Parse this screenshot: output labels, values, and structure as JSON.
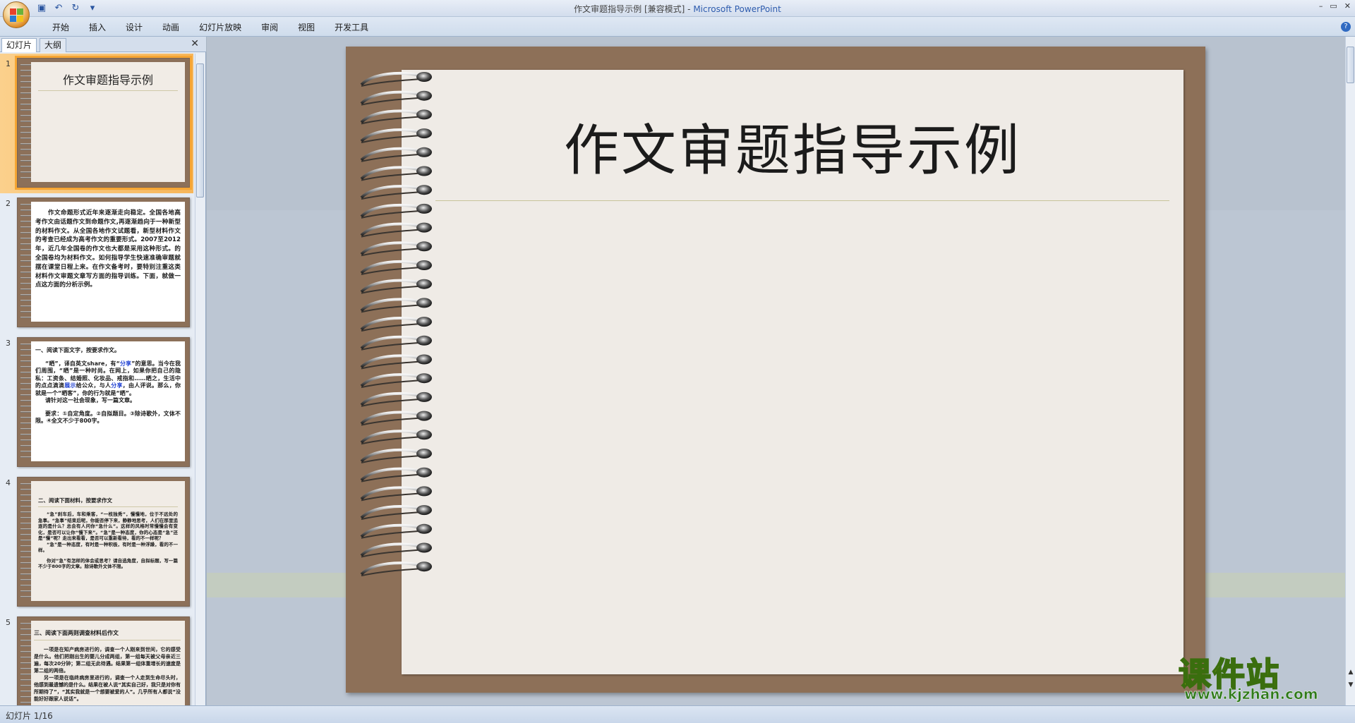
{
  "window": {
    "title": "作文审题指导示例 [兼容模式]",
    "app": "Microsoft PowerPoint",
    "separator": " - "
  },
  "quick_access": [
    {
      "name": "save-icon",
      "glyph": "▣"
    },
    {
      "name": "undo-icon",
      "glyph": "↶"
    },
    {
      "name": "redo-icon",
      "glyph": "↻"
    },
    {
      "name": "customize-icon",
      "glyph": "▾"
    }
  ],
  "window_buttons": [
    "–",
    "▭",
    "✕"
  ],
  "ribbon_tabs": [
    "开始",
    "插入",
    "设计",
    "动画",
    "幻灯片放映",
    "审阅",
    "视图",
    "开发工具"
  ],
  "help_glyph": "?",
  "panel": {
    "tabs": [
      "幻灯片",
      "大纲"
    ],
    "close_glyph": "✕"
  },
  "thumbnails": [
    {
      "num": "1",
      "title": "作文审题指导示例"
    },
    {
      "num": "2",
      "text": "作文命题形式近年来逐渐走向稳定。全国各地高考作文由话题作文到命题作文,再逐渐趋向于一种新型的材料作文。从全国各地作文试题看，新型材料作文的考查已经成为高考作文的重要形式。2007至2012年，近几年全国卷的作文也大都是采用这种形式。的全国卷均为材料作文。如何指导学生快速准确审题就摆在课堂日程上来。在作文备考时，要特别注重这类材料作文审题文章写方面的指导训练。下面，就做一点这方面的分析示例。"
    },
    {
      "num": "3",
      "heading": "一、阅读下面文字，按要求作文。",
      "body1": "“晒”，译自英文share，有“",
      "blue1": "分享",
      "body2": "”的意思。当今在我们周围，“晒”是一种时尚。在网上，如果你把自己的隐私：工资条、结婚照、化妆品、戒指和……晒之，生活中的点点滴滴",
      "blue2": "展示",
      "body3": "给公众，与人",
      "blue3": "分享",
      "body4": "，由人评说。那么，你就是一个“晒客”，你的行为就是“晒”。",
      "body5": "请针对这一社会现象，写一篇文章。",
      "req": "要求：①自定角度。②自拟题目。③除诗歌外，文体不限。④全文不少于800字。"
    },
    {
      "num": "4",
      "heading": "二、阅读下面材料，按要求作文",
      "body": "“急”刹车后，车和乘客，“一枝独秀”，慢慢地，位于不远处的急事。“急事”结束后呢，你能否停下来，静静地思考，人们在那里追逐的是什么？总会有人问你“急什么”。这样的风格时常慢慢会有变化，是否可以让你“慢下来”。“急”是一种态度，你的心态是“急”还是“慢”呢？走出来看看，是否可以重新看待，看的不一样呢？",
      "body2": "“急”是一种态度，有时是一种积极，有时是一种浮躁，看的不一样。",
      "task": "你对“急”有怎样的体会或思考？请自选角度，自拟标题，写一篇不少于800字的文章。除诗歌外文体不限。"
    },
    {
      "num": "5",
      "heading": "三、阅读下面两则调查材料后作文",
      "body": "一项是在知产病房进行的，调查一个人刚来到世间，它的感受是什么。他们把刚出生的婴儿分成两组，第一组每天被父母亲近三遍，每次20分钟；第二组无此待遇。结果第一组体重增长的速度是第二组的两倍。",
      "body2": "另一项是在临终病房里进行的，调查一个人走到生命尽头时，他感到最遗憾的是什么。结果在被人说“其实自己好，我只是对你有所期待了”，“其实我就是一个想要被爱的人”。几乎所有人都说“没能好好跟家人说话”。"
    }
  ],
  "slide": {
    "title": "作文审题指导示例"
  },
  "status": {
    "text": "幻灯片 1/16"
  },
  "watermark": {
    "cn": "课件站",
    "url": "www.kjzhan.com"
  },
  "colors": {
    "slide_frame": "#8d7058",
    "slide_page": "#efebe6",
    "selection": "#f6a533",
    "ribbon": "#d3dded"
  }
}
